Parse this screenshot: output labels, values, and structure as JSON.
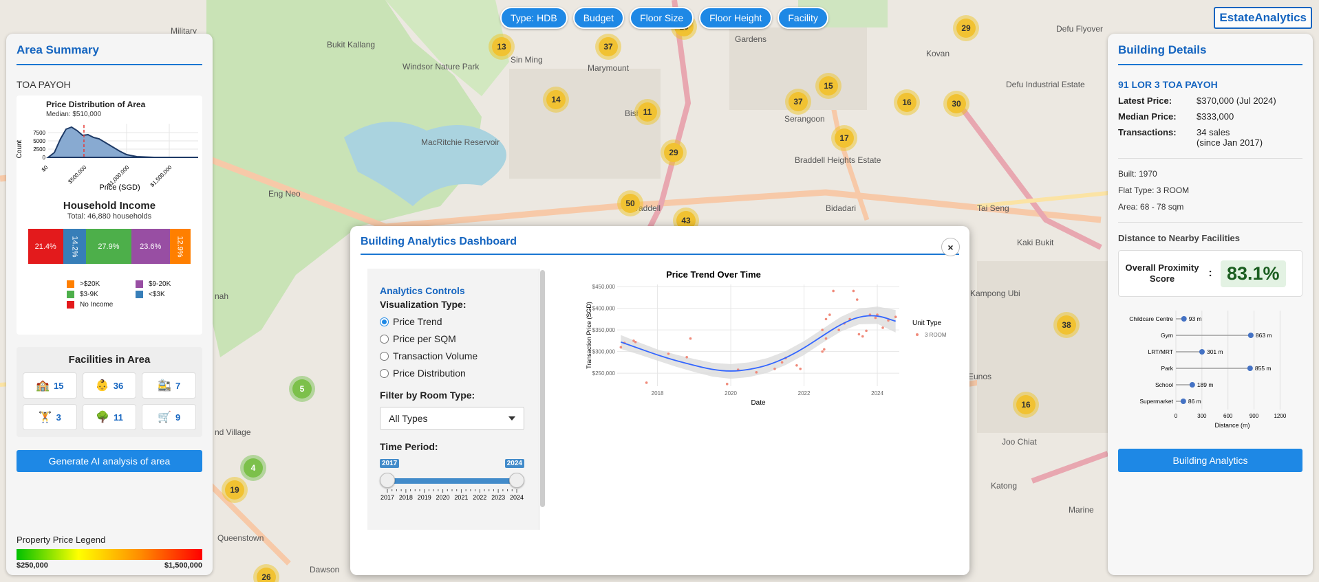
{
  "brand": "EstateAnalytics",
  "filters": [
    "Type: HDB",
    "Budget",
    "Floor Size",
    "Floor Height",
    "Facility"
  ],
  "map": {
    "labels": [
      {
        "text": "Military",
        "x": 248,
        "y": 38
      },
      {
        "text": "Sin Ming",
        "x": 742,
        "y": 80
      },
      {
        "text": "Marymount",
        "x": 854,
        "y": 92
      },
      {
        "text": "Gardens",
        "x": 1068,
        "y": 50
      },
      {
        "text": "Kovan",
        "x": 1346,
        "y": 71
      },
      {
        "text": "Defu Flyover",
        "x": 1535,
        "y": 35
      },
      {
        "text": "Windsor Nature Park",
        "x": 585,
        "y": 90
      },
      {
        "text": "Bukit Kallang",
        "x": 475,
        "y": 58
      },
      {
        "text": "MacRitchie Reservoir",
        "x": 612,
        "y": 200
      },
      {
        "text": "Bishan",
        "x": 908,
        "y": 158
      },
      {
        "text": "Serangoon",
        "x": 1140,
        "y": 166
      },
      {
        "text": "Defu Industrial Estate",
        "x": 1462,
        "y": 116
      },
      {
        "text": "Braddell Heights Estate",
        "x": 1155,
        "y": 226
      },
      {
        "text": "Bidadari",
        "x": 1200,
        "y": 296
      },
      {
        "text": "Tai Seng",
        "x": 1420,
        "y": 296
      },
      {
        "text": "Kaki Bukit",
        "x": 1478,
        "y": 346
      },
      {
        "text": "Kampong Ubi",
        "x": 1410,
        "y": 420
      },
      {
        "text": "Eunos",
        "x": 1407,
        "y": 541
      },
      {
        "text": "Joo Chiat",
        "x": 1456,
        "y": 636
      },
      {
        "text": "Katong",
        "x": 1440,
        "y": 700
      },
      {
        "text": "Marine",
        "x": 1553,
        "y": 735
      },
      {
        "text": "Braddell",
        "x": 916,
        "y": 296
      },
      {
        "text": "Queenstown",
        "x": 316,
        "y": 776
      },
      {
        "text": "nd Village",
        "x": 312,
        "y": 622
      },
      {
        "text": "Dawson",
        "x": 450,
        "y": 822
      },
      {
        "text": "nah",
        "x": 312,
        "y": 424
      },
      {
        "text": "Eng Neo",
        "x": 390,
        "y": 275
      }
    ],
    "clusters": [
      {
        "n": "13",
        "x": 729,
        "y": 68
      },
      {
        "n": "37",
        "x": 884,
        "y": 68
      },
      {
        "n": "10",
        "x": 994,
        "y": 39
      },
      {
        "n": "29",
        "x": 1404,
        "y": 41
      },
      {
        "n": "14",
        "x": 808,
        "y": 145
      },
      {
        "n": "11",
        "x": 941,
        "y": 163
      },
      {
        "n": "37",
        "x": 1160,
        "y": 148
      },
      {
        "n": "15",
        "x": 1204,
        "y": 125
      },
      {
        "n": "16",
        "x": 1318,
        "y": 149
      },
      {
        "n": "30",
        "x": 1390,
        "y": 151
      },
      {
        "n": "17",
        "x": 1227,
        "y": 201
      },
      {
        "n": "29",
        "x": 979,
        "y": 222
      },
      {
        "n": "50",
        "x": 916,
        "y": 296
      },
      {
        "n": "43",
        "x": 997,
        "y": 321
      },
      {
        "n": "38",
        "x": 1550,
        "y": 473
      },
      {
        "n": "16",
        "x": 1491,
        "y": 589
      },
      {
        "n": "19",
        "x": 341,
        "y": 713
      },
      {
        "n": "26",
        "x": 387,
        "y": 840
      }
    ],
    "green_clusters": [
      {
        "n": "5",
        "x": 439,
        "y": 566
      },
      {
        "n": "4",
        "x": 368,
        "y": 681
      }
    ]
  },
  "left": {
    "title": "Area Summary",
    "area": "TOA PAYOH",
    "price_chart": {
      "title": "Price Distribution of Area",
      "median_label": "Median: $510,000",
      "xlabel": "Price (SGD)",
      "ylabel": "Count",
      "yticks": [
        "7500",
        "5000",
        "2500",
        "0"
      ],
      "xticks": [
        "$0",
        "$500,000",
        "$1,000,000",
        "$1,500,000"
      ]
    },
    "income": {
      "title": "Household Income",
      "total": "Total: 46,880 households",
      "segments": [
        {
          "label": "21.4%",
          "value": 21.4,
          "color": "#e31a1c"
        },
        {
          "label": "14.2%",
          "value": 14.2,
          "color": "#377eb8"
        },
        {
          "label": "27.9%",
          "value": 27.9,
          "color": "#4daf4a"
        },
        {
          "label": "23.6%",
          "value": 23.6,
          "color": "#984ea3"
        },
        {
          "label": "12.9%",
          "value": 12.9,
          "color": "#ff7f00"
        }
      ],
      "legend": [
        {
          "label": ">$20K",
          "color": "#ff7f00"
        },
        {
          "label": "$9-20K",
          "color": "#984ea3"
        },
        {
          "label": "$3-9K",
          "color": "#4daf4a"
        },
        {
          "label": "<$3K",
          "color": "#377eb8"
        },
        {
          "label": "No Income",
          "color": "#e31a1c"
        }
      ]
    },
    "facilities": {
      "title": "Facilities in Area",
      "items": [
        {
          "icon": "🏫",
          "name": "school",
          "count": "15"
        },
        {
          "icon": "👶",
          "name": "childcare",
          "count": "36"
        },
        {
          "icon": "🚉",
          "name": "mrt",
          "count": "7"
        },
        {
          "icon": "🏋",
          "name": "gym",
          "count": "3"
        },
        {
          "icon": "🌳",
          "name": "park",
          "count": "11"
        },
        {
          "icon": "🛒",
          "name": "supermarket",
          "count": "9"
        }
      ]
    },
    "ai_button": "Generate AI analysis of area",
    "price_legend": {
      "title": "Property Price Legend",
      "min": "$250,000",
      "max": "$1,500,000"
    }
  },
  "right": {
    "title": "Building Details",
    "address": "91 LOR 3 TOA PAYOH",
    "latest_label": "Latest Price:",
    "latest_value": "$370,000 (Jul 2024)",
    "median_label": "Median Price:",
    "median_value": "$333,000",
    "tx_label": "Transactions:",
    "tx_value": "34 sales",
    "tx_since": "(since Jan 2017)",
    "built": "Built: 1970",
    "flat_type": "Flat Type: 3 ROOM",
    "area": "Area: 68 - 78 sqm",
    "dist_title": "Distance to Nearby Facilities",
    "score_label": "Overall Proximity Score",
    "score_colon": ":",
    "score_value": "83.1%",
    "distance_chart": {
      "xlabel": "Distance (m)",
      "xticks": [
        0,
        300,
        600,
        900,
        1200
      ],
      "items": [
        {
          "name": "Childcare Centre",
          "value": 93,
          "label": "93 m"
        },
        {
          "name": "Gym",
          "value": 863,
          "label": "863 m"
        },
        {
          "name": "LRT/MRT",
          "value": 301,
          "label": "301 m"
        },
        {
          "name": "Park",
          "value": 855,
          "label": "855 m"
        },
        {
          "name": "School",
          "value": 189,
          "label": "189 m"
        },
        {
          "name": "Supermarket",
          "value": 86,
          "label": "86 m"
        }
      ]
    },
    "analytics_button": "Building Analytics"
  },
  "modal": {
    "title": "Building Analytics Dashboard",
    "close": "×",
    "controls_title": "Analytics Controls",
    "viz_label": "Visualization Type:",
    "viz_options": [
      "Price Trend",
      "Price per SQM",
      "Transaction Volume",
      "Price Distribution"
    ],
    "viz_selected": 0,
    "filter_label": "Filter by Room Type:",
    "filter_value": "All Types",
    "period_label": "Time Period:",
    "period_from": "2017",
    "period_to": "2024",
    "period_ticks": [
      "2017",
      "2018",
      "2019",
      "2020",
      "2021",
      "2022",
      "2023",
      "2024"
    ]
  },
  "chart_data": {
    "type": "scatter",
    "title": "Price Trend Over Time",
    "xlabel": "Date",
    "ylabel": "Transaction Price (SGD)",
    "x_ticks": [
      2018,
      2020,
      2022,
      2024
    ],
    "y_ticks": [
      250000,
      300000,
      350000,
      400000,
      450000
    ],
    "y_tick_labels": [
      "$250,000",
      "$300,000",
      "$350,000",
      "$400,000",
      "$450,000"
    ],
    "xlim": [
      2016.9,
      2024.6
    ],
    "ylim": [
      220000,
      455000
    ],
    "legend_title": "Unit Type",
    "series": [
      {
        "name": "3 ROOM",
        "points": [
          [
            2017.0,
            310000
          ],
          [
            2017.1,
            320000
          ],
          [
            2017.35,
            325000
          ],
          [
            2017.4,
            322000
          ],
          [
            2017.7,
            228000
          ],
          [
            2018.3,
            295000
          ],
          [
            2018.9,
            330000
          ],
          [
            2018.8,
            287000
          ],
          [
            2019.9,
            225000
          ],
          [
            2020.2,
            258000
          ],
          [
            2020.7,
            252000
          ],
          [
            2021.2,
            260000
          ],
          [
            2021.4,
            275000
          ],
          [
            2021.5,
            285000
          ],
          [
            2021.8,
            268000
          ],
          [
            2021.9,
            260000
          ],
          [
            2022.5,
            300000
          ],
          [
            2022.55,
            305000
          ],
          [
            2022.6,
            330000
          ],
          [
            2022.5,
            350000
          ],
          [
            2022.6,
            375000
          ],
          [
            2022.7,
            385000
          ],
          [
            2022.8,
            440000
          ],
          [
            2022.95,
            350000
          ],
          [
            2023.1,
            365000
          ],
          [
            2023.25,
            375000
          ],
          [
            2023.35,
            440000
          ],
          [
            2023.45,
            420000
          ],
          [
            2023.5,
            340000
          ],
          [
            2023.6,
            335000
          ],
          [
            2023.7,
            348000
          ],
          [
            2023.8,
            385000
          ],
          [
            2023.95,
            378000
          ],
          [
            2024.0,
            385000
          ],
          [
            2024.15,
            355000
          ],
          [
            2024.3,
            372000
          ],
          [
            2024.5,
            380000
          ]
        ],
        "trend": [
          [
            2017.0,
            322000
          ],
          [
            2017.5,
            307000
          ],
          [
            2018.0,
            292000
          ],
          [
            2018.5,
            279000
          ],
          [
            2019.0,
            268000
          ],
          [
            2019.5,
            258000
          ],
          [
            2020.0,
            254000
          ],
          [
            2020.5,
            258000
          ],
          [
            2021.0,
            268000
          ],
          [
            2021.5,
            285000
          ],
          [
            2022.0,
            308000
          ],
          [
            2022.5,
            336000
          ],
          [
            2023.0,
            363000
          ],
          [
            2023.5,
            381000
          ],
          [
            2024.0,
            384000
          ],
          [
            2024.5,
            370000
          ]
        ],
        "band": [
          16000,
          14000,
          13000,
          14000,
          15000,
          16000,
          17000,
          17000,
          17000,
          16000,
          16000,
          16000,
          17000,
          18000,
          20000,
          26000
        ]
      }
    ]
  }
}
